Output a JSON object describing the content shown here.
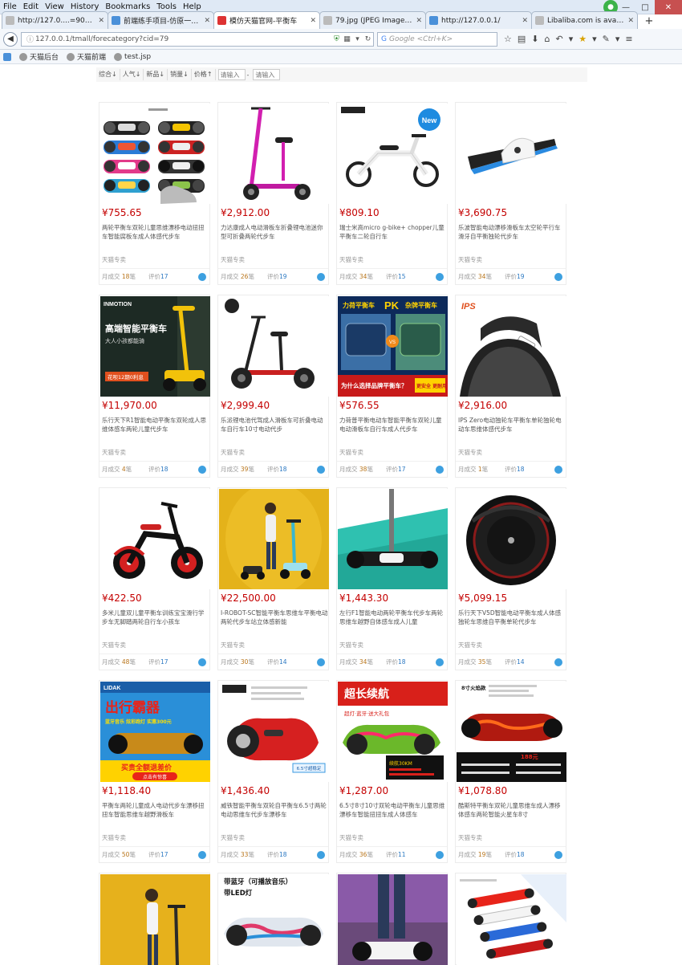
{
  "browser": {
    "menu": [
      "File",
      "Edit",
      "View",
      "History",
      "Bookmarks",
      "Tools",
      "Help"
    ],
    "tabs": [
      {
        "label": "http://127.0....=900#addStep",
        "active": false
      },
      {
        "label": "前端练手项目-仿原一个小...",
        "active": false
      },
      {
        "label": "模仿天猫官网-平衡车",
        "active": true
      },
      {
        "label": "79.jpg (JPEG Image, 952...",
        "active": false
      },
      {
        "label": "http://127.0.0.1/",
        "active": false
      },
      {
        "label": "Libaliba.com is available...",
        "active": false
      }
    ],
    "url": "127.0.0.1/tmall/forecategory?cid=79",
    "search_placeholder": "Google <Ctrl+K>",
    "bookmarks": [
      "天猫后台",
      "天猫前端",
      "test.jsp"
    ]
  },
  "sort": {
    "options": [
      "综合",
      "人气",
      "新品",
      "销量",
      "价格"
    ],
    "min_placeholder": "请输入",
    "max_placeholder": "请输入"
  },
  "labels": {
    "sales_prefix": "月成交",
    "sales_suffix": "笔",
    "review_prefix": "评价"
  },
  "products": [
    {
      "price": "¥755.65",
      "title": "两轮平衡车双轮儿童思维漂移电动扭扭车智能腐板车成人体感代步车",
      "shop": "天猫专卖",
      "sales": "18",
      "reviews": "17"
    },
    {
      "price": "¥2,912.00",
      "title": "力达康成人电动滑板车折叠锂电池迷你型可折叠两轮代步车",
      "shop": "天猫专卖",
      "sales": "26",
      "reviews": "19"
    },
    {
      "price": "¥809.10",
      "title": "瑞士米高micro g-bike+ chopper儿童平衡车二轮自行车",
      "shop": "天猫专卖",
      "sales": "34",
      "reviews": "15"
    },
    {
      "price": "¥3,690.75",
      "title": "乐波智能电动漂移滑板车太空轮平行车滑牙自平衡独轮代步车",
      "shop": "天猫专卖",
      "sales": "34",
      "reviews": "19"
    },
    {
      "price": "¥11,970.00",
      "title": "乐行天下R1智能电动平衡车双轮成人思维体感车两轮儿童代步车",
      "shop": "天猫专卖",
      "sales": "4",
      "reviews": "18"
    },
    {
      "price": "¥2,999.40",
      "title": "乐派锂电池代驾成人滑板车可折叠电动车自行车10寸电动代步",
      "shop": "天猫专卖",
      "sales": "39",
      "reviews": "18"
    },
    {
      "price": "¥576.55",
      "title": "力荷普平衡电动车智能平衡车双轮儿童电动滑板车自行车成人代步车",
      "shop": "天猫专卖",
      "sales": "38",
      "reviews": "17"
    },
    {
      "price": "¥2,916.00",
      "title": "IPS Zero电动独轮车平衡车单轮独轮电动车思维体感代步车",
      "shop": "天猫专卖",
      "sales": "1",
      "reviews": "18"
    },
    {
      "price": "¥422.50",
      "title": "多米儿童双儿童平衡车训练宝宝滑行学步车无脚踏两轮自行车小孩车",
      "shop": "天猫专卖",
      "sales": "48",
      "reviews": "17"
    },
    {
      "price": "¥22,500.00",
      "title": "I-ROBOT-SC智能平衡车思维车平衡电动两轮代步车站立体感新能",
      "shop": "天猫专卖",
      "sales": "30",
      "reviews": "14"
    },
    {
      "price": "¥1,443.30",
      "title": "左行F1智能电动两轮平衡车代步车两轮思维车越野自体感车成人儿童",
      "shop": "天猫专卖",
      "sales": "34",
      "reviews": "18"
    },
    {
      "price": "¥5,099.15",
      "title": "乐行天下V5D智能电动平衡车成人体感独轮车思维自平衡单轮代步车",
      "shop": "天猫专卖",
      "sales": "35",
      "reviews": "14"
    },
    {
      "price": "¥1,118.40",
      "title": "平衡车两轮儿童成人电动代步车漂移扭扭车智能思维车越野滑板车",
      "shop": "天猫专卖",
      "sales": "50",
      "reviews": "17"
    },
    {
      "price": "¥1,436.40",
      "title": "威铁智能平衡车双轮自平衡车6.5寸两轮电动思维车代步车漂移车",
      "shop": "天猫专卖",
      "sales": "33",
      "reviews": "18"
    },
    {
      "price": "¥1,287.00",
      "title": "6.5寸8寸10寸双轮电动平衡车儿童思维漂移车智能扭扭车成人体感车",
      "shop": "天猫专卖",
      "sales": "36",
      "reviews": "11"
    },
    {
      "price": "¥1,078.80",
      "title": "酷斯特平衡车双轮儿童思维车成人漂移体感车两轮智能火星车8寸",
      "shop": "天猫专卖",
      "sales": "19",
      "reviews": "18"
    },
    {
      "price": "",
      "title": "",
      "shop": "",
      "sales": "",
      "reviews": ""
    },
    {
      "price": "",
      "title": "",
      "shop": "",
      "sales": "",
      "reviews": ""
    },
    {
      "price": "",
      "title": "",
      "shop": "",
      "sales": "",
      "reviews": ""
    },
    {
      "price": "",
      "title": "",
      "shop": "",
      "sales": "",
      "reviews": ""
    }
  ],
  "image_text": {
    "p5_brand": "INMOTION",
    "p5_headline": "高端智能平衡车",
    "p5_sub": "大人小孩都能骑",
    "p5_badge": "花呗12期0利息",
    "p7_head_a": "力荷平衡车",
    "p7_pk": "PK",
    "p7_head_b": "杂牌平衡车",
    "p7_vs": "VS",
    "p7_footer": "为什么选择品牌平衡车？",
    "p7_footer2": "更安全 更耐用",
    "p8_brand": "IPS",
    "p13_brand": "LIDAK",
    "p13_headline": "出行霸器",
    "p13_sub": "蓝牙音乐 炫彩跑灯 实惠300元",
    "p13_banner": "买贵全额退差价",
    "p13_banner2": "点击有惊喜",
    "p14_size": "6.5寸超稳定",
    "p15_headline": "超长续航",
    "p15_sub": "超灯·蓝牙·送大礼包",
    "p15_specs": "续航30KM",
    "p16_title": "8寸火焰款",
    "p16_price": "188元",
    "p18_l1": "带蓝牙（可播放音乐）",
    "p18_l2": "带LED灯"
  }
}
